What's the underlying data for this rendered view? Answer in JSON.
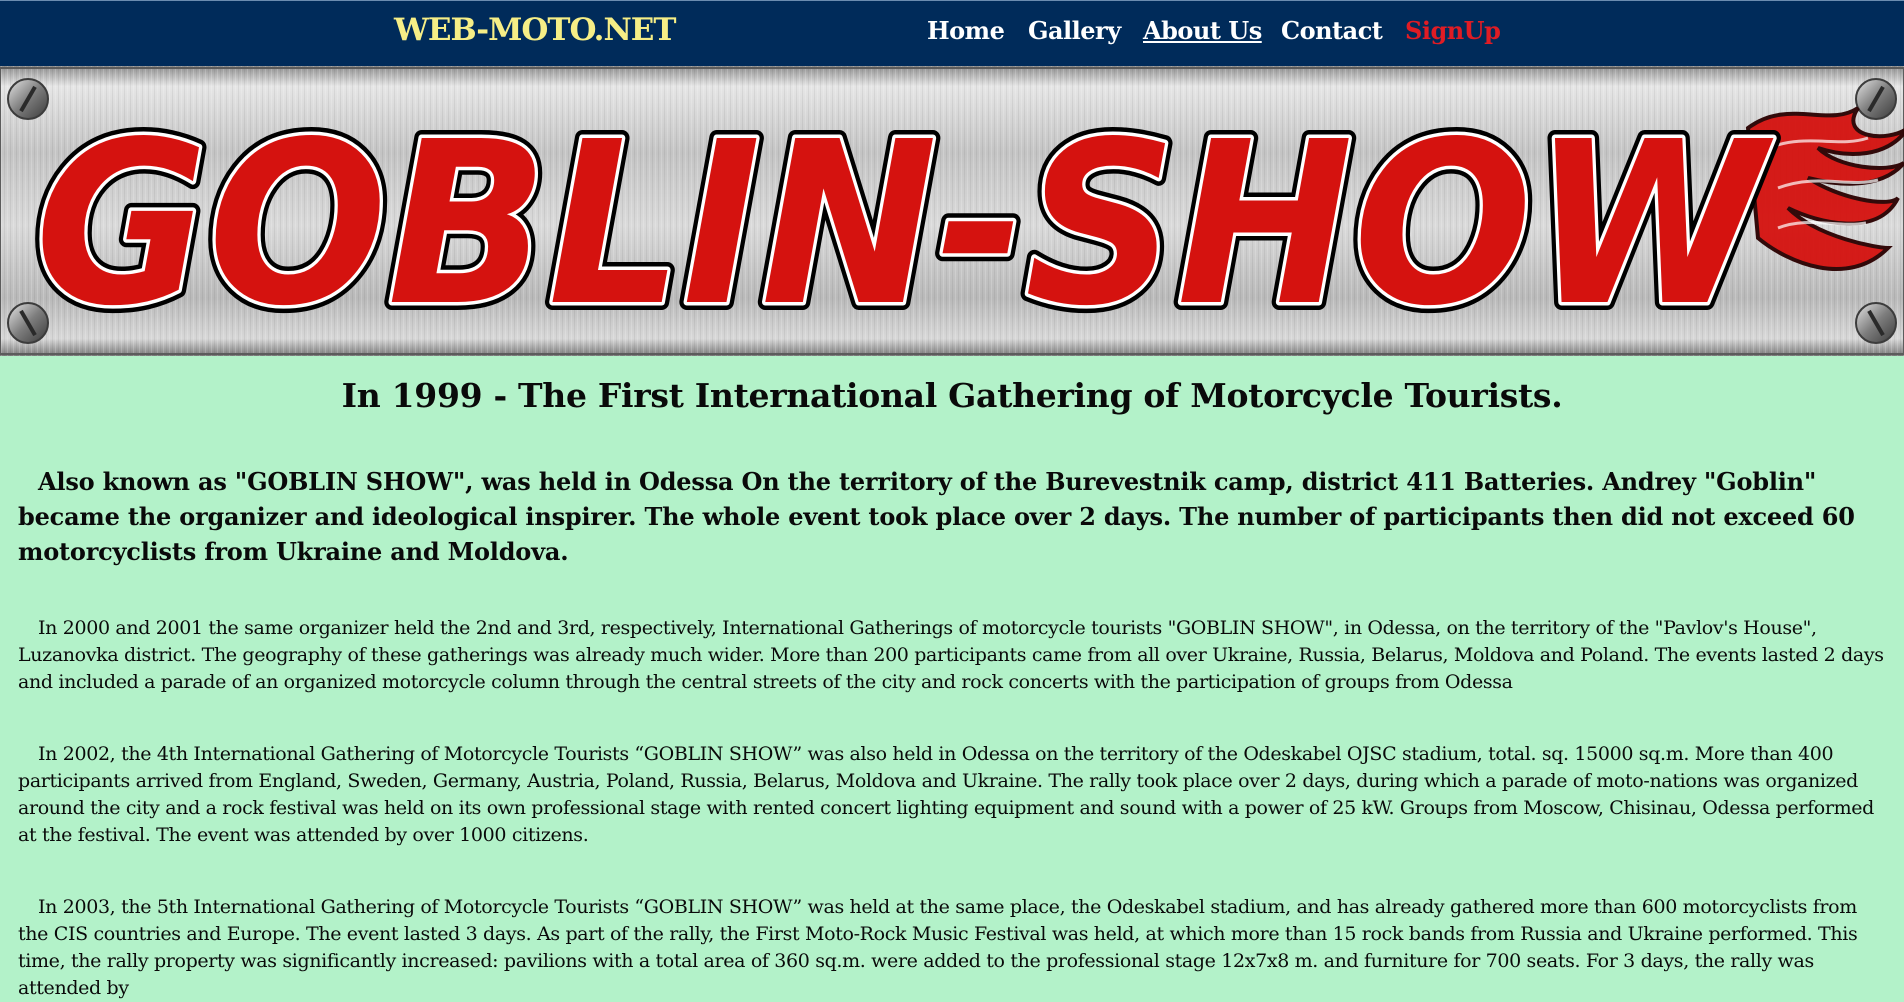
{
  "nav": {
    "brand": "WEB-MOTO.NET",
    "links": [
      "Home",
      "Gallery",
      "About Us",
      "Contact",
      "SignUp"
    ]
  },
  "banner": {
    "text": "GOBLIN-SHOW",
    "colors": {
      "letters": "#d5120f",
      "plate": "#c9c9c9"
    }
  },
  "main": {
    "heading": "In 1999 - The First International Gathering of Motorcycle Tourists.",
    "paragraphs": [
      "Also known as \"GOBLIN SHOW\", was held in Odessa On the territory of the Burevestnik camp, district 411 Batteries. Andrey \"Goblin\" became the organizer and ideological inspirer. The whole event took place over 2 days. The number of participants then did not exceed 60 motorcyclists from Ukraine and Moldova.",
      "In 2000 and 2001 the same organizer held the 2nd and 3rd, respectively, International Gatherings of motorcycle tourists \"GOBLIN SHOW\", in Odessa, on the territory of the \"Pavlov's House\", Luzanovka district. The geography of these gatherings was already much wider. More than 200 participants came from all over Ukraine, Russia, Belarus, Moldova and Poland. The events lasted 2 days and included a parade of an organized motorcycle column through the central streets of the city and rock concerts with the participation of groups from Odessa",
      "In 2002, the 4th International Gathering of Motorcycle Tourists “GOBLIN SHOW” was also held in Odessa on the territory of the Odeskabel OJSC stadium, total. sq. 15000 sq.m. More than 400 participants arrived from England, Sweden, Germany, Austria, Poland, Russia, Belarus, Moldova and Ukraine. The rally took place over 2 days, during which a parade of moto-nations was organized around the city and a rock festival was held on its own professional stage with rented concert lighting equipment and sound with a power of 25 kW. Groups from Moscow, Chisinau, Odessa performed at the festival. The event was attended by over 1000 citizens.",
      "In 2003, the 5th International Gathering of Motorcycle Tourists “GOBLIN SHOW” was held at the same place, the Odeskabel stadium, and has already gathered more than 600 motorcyclists from the CIS countries and Europe. The event lasted 3 days. As part of the rally, the First Moto-Rock Music Festival was held, at which more than 15 rock bands from Russia and Ukraine performed. This time, the rally property was significantly increased: pavilions with a total area of 360 sq.m. were added to the professional stage 12x7x8 m. and furniture for 700 seats. For 3 days, the rally was attended by"
    ]
  }
}
